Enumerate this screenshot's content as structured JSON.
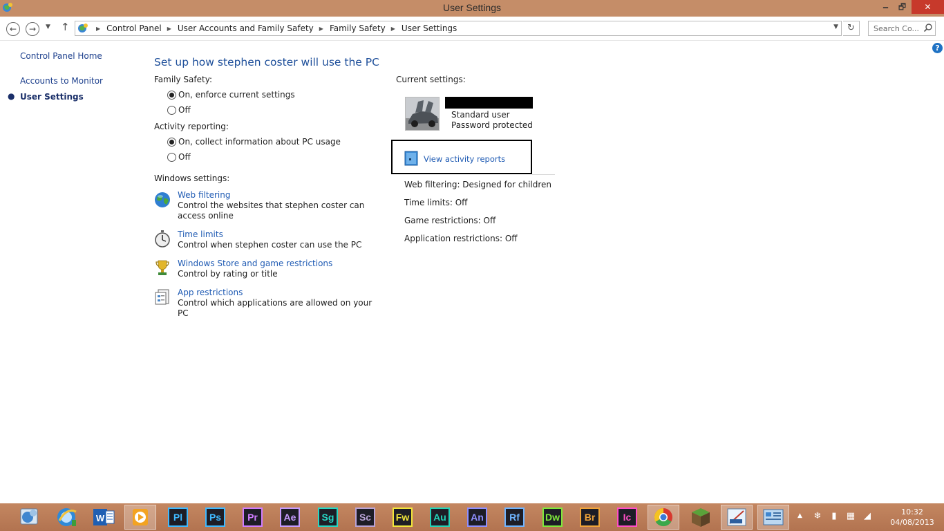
{
  "window": {
    "title": "User Settings",
    "min": "🗕",
    "max": "🗗",
    "close": "✕"
  },
  "breadcrumb": [
    "Control Panel",
    "User Accounts and Family Safety",
    "Family Safety",
    "User Settings"
  ],
  "search": {
    "placeholder": "Search Co..."
  },
  "help": "?",
  "leftnav": {
    "home": "Control Panel Home",
    "accounts": "Accounts to Monitor",
    "user_settings": "User Settings"
  },
  "main": {
    "heading": "Set up how stephen coster will use the PC",
    "family_safety": {
      "label": "Family Safety:",
      "on": "On, enforce current settings",
      "off": "Off",
      "selected": "on"
    },
    "activity_reporting": {
      "label": "Activity reporting:",
      "on": "On, collect information about PC usage",
      "off": "Off",
      "selected": "on"
    },
    "windows_settings": {
      "label": "Windows settings:",
      "items": [
        {
          "link": "Web filtering",
          "desc": "Control the websites that stephen coster can access online",
          "icon": "globe-icon"
        },
        {
          "link": "Time limits",
          "desc": "Control when stephen coster can use the PC",
          "icon": "stopwatch-icon"
        },
        {
          "link": "Windows Store and game restrictions",
          "desc": "Control by rating or title",
          "icon": "trophy-icon"
        },
        {
          "link": "App restrictions",
          "desc": "Control which applications are allowed on your PC",
          "icon": "app-list-icon"
        }
      ]
    }
  },
  "current": {
    "label": "Current settings:",
    "account_type": "Standard user",
    "password": "Password protected",
    "report_link": "View activity reports",
    "settings": [
      "Web filtering: Designed for children",
      "Time limits: Off",
      "Game restrictions: Off",
      "Application restrictions: Off"
    ]
  },
  "taskbar": {
    "adobe_apps": [
      {
        "abbr": "Pl",
        "color": "#3fb9ff"
      },
      {
        "abbr": "Ps",
        "color": "#3fb9ff"
      },
      {
        "abbr": "Pr",
        "color": "#d07cff"
      },
      {
        "abbr": "Ae",
        "color": "#c79cff"
      },
      {
        "abbr": "Sg",
        "color": "#26d6c4"
      },
      {
        "abbr": "Sc",
        "color": "#b9a3d6"
      },
      {
        "abbr": "Fw",
        "color": "#f2e63a"
      },
      {
        "abbr": "Au",
        "color": "#24d3b8"
      },
      {
        "abbr": "An",
        "color": "#8f8fff"
      },
      {
        "abbr": "Rf",
        "color": "#6fb4ff"
      },
      {
        "abbr": "Dw",
        "color": "#7ee83b"
      },
      {
        "abbr": "Br",
        "color": "#f0a43a"
      },
      {
        "abbr": "Ic",
        "color": "#ff4fc7"
      }
    ],
    "clock": {
      "time": "10:32",
      "date": "04/08/2013"
    }
  }
}
